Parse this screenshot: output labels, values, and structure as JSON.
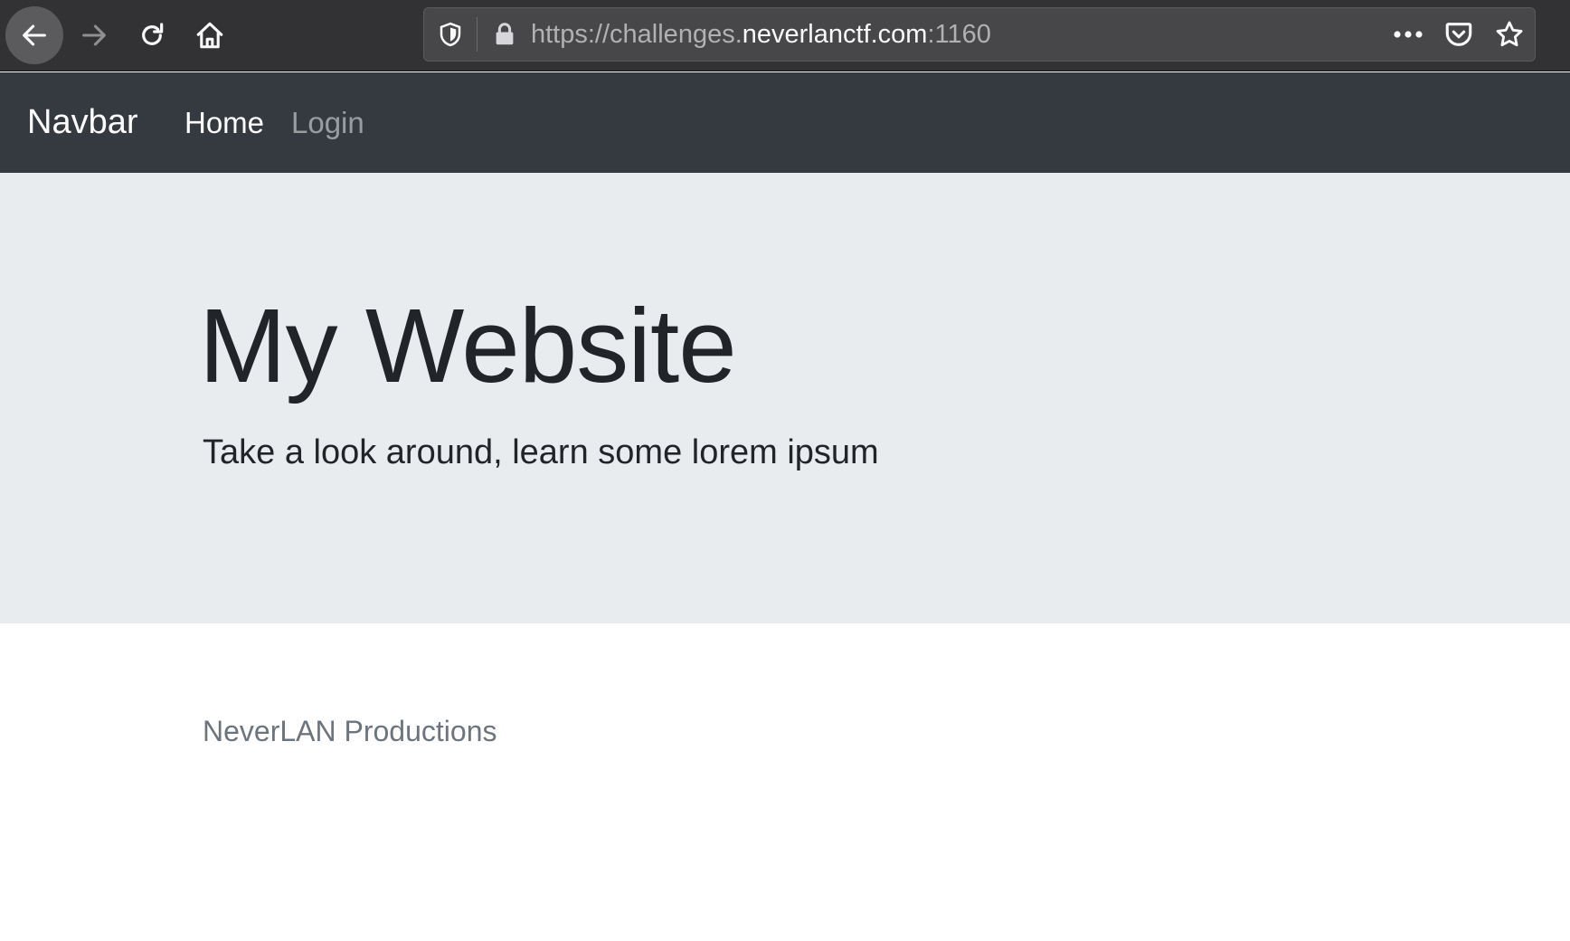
{
  "browser": {
    "url_prefix": "https://challenges.",
    "url_host": "neverlanctf.com",
    "url_suffix": ":1160",
    "icons": {
      "back": "arrow-left-icon",
      "forward": "arrow-right-icon",
      "reload": "reload-icon",
      "home": "home-icon",
      "tracking": "shield-icon",
      "lock": "lock-icon",
      "more": "more-dots-icon",
      "pocket": "pocket-icon",
      "bookmark": "star-icon"
    }
  },
  "navbar": {
    "brand": "Navbar",
    "links": [
      {
        "label": "Home",
        "active": true
      },
      {
        "label": "Login",
        "active": false
      }
    ]
  },
  "jumbotron": {
    "title": "My Website",
    "lead": "Take a look around, learn some lorem ipsum"
  },
  "footer": {
    "text": "NeverLAN Productions"
  },
  "colors": {
    "chrome": "#323234",
    "navbar": "#343a40",
    "jumbotron": "#e9ecef",
    "text_dark": "#212529",
    "text_muted": "#6c757d"
  }
}
